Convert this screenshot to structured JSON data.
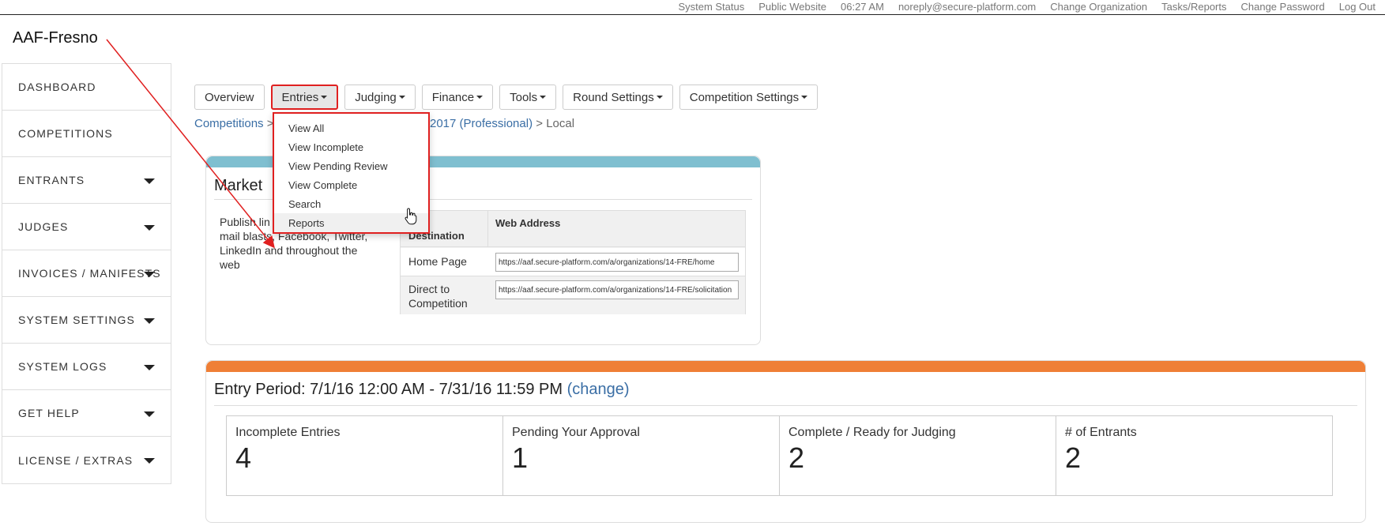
{
  "topbar": {
    "links": [
      "System Status",
      "Public Website",
      "06:27 AM",
      "noreply@secure-platform.com",
      "Change Organization",
      "Tasks/Reports",
      "Change Password",
      "Log Out"
    ]
  },
  "org_title": "AAF-Fresno",
  "sidebar": {
    "items": [
      {
        "label": "DASHBOARD"
      },
      {
        "label": "COMPETITIONS"
      },
      {
        "label": "ENTRANTS"
      },
      {
        "label": "JUDGES"
      },
      {
        "label": "INVOICES / MANIFESTS"
      },
      {
        "label": "SYSTEM SETTINGS"
      },
      {
        "label": "SYSTEM LOGS"
      },
      {
        "label": "GET HELP"
      },
      {
        "label": "LICENSE / EXTRAS"
      }
    ]
  },
  "nav": {
    "overview": "Overview",
    "entries": "Entries",
    "judging": "Judging",
    "finance": "Finance",
    "tools": "Tools",
    "round_settings": "Round Settings",
    "competition_settings": "Competition Settings"
  },
  "breadcrumb": {
    "competitions": "Competitions",
    "sep1": ">",
    "competition": "2017 (Professional)",
    "sep2": ">",
    "current": "Local"
  },
  "entries_menu": {
    "items": [
      "View All",
      "View Incomplete",
      "View Pending Review",
      "View Complete",
      "Search",
      "Reports"
    ]
  },
  "marketing": {
    "title": "Market",
    "text_line1": "Publish lin",
    "text_rest": "mail blasts, Facebook, Twitter, LinkedIn and throughout the web",
    "col_destination": "Destination",
    "col_web_address": "Web Address",
    "rows": [
      {
        "destination": "Home Page",
        "url": "https://aaf.secure-platform.com/a/organizations/14-FRE/home"
      },
      {
        "destination": "Direct to Competition",
        "url": "https://aaf.secure-platform.com/a/organizations/14-FRE/solicitation"
      }
    ]
  },
  "entry_period": {
    "label": "Entry Period: 7/1/16 12:00 AM - 7/31/16 11:59 PM",
    "change_link": "(change)",
    "stats": [
      {
        "label": "Incomplete Entries",
        "value": "4"
      },
      {
        "label": "Pending Your Approval",
        "value": "1"
      },
      {
        "label": "Complete / Ready for Judging",
        "value": "2"
      },
      {
        "label": "# of Entrants",
        "value": "2"
      }
    ]
  },
  "colors": {
    "annotation_red": "#e02020",
    "marketing_bar": "#7fbfd0",
    "entry_bar": "#ef7f36",
    "link_blue": "#3a6ea5"
  }
}
